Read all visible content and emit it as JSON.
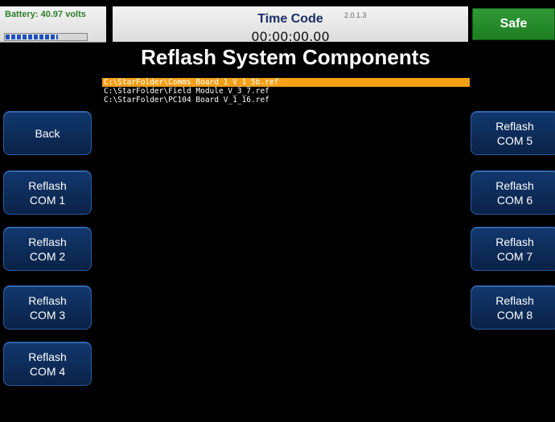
{
  "header": {
    "battery_label": "Battery: 40.97 volts",
    "battery_level": 0.65,
    "timecode_title": "Time Code",
    "version": "2.0.1.3",
    "timecode_value": "00:00:00.00",
    "safe_label": "Safe"
  },
  "page_title": "Reflash System Components",
  "files": [
    {
      "path": "C:\\StarFolder\\Comms Board 1 V_1_5b.ref",
      "selected": true
    },
    {
      "path": "C:\\StarFolder\\Field Module V_3_7.ref",
      "selected": false
    },
    {
      "path": "C:\\StarFolder\\PC104 Board V_1_16.ref",
      "selected": false
    }
  ],
  "buttons": {
    "back": "Back",
    "reflash_word": "Reflash",
    "com1": "COM 1",
    "com2": "COM 2",
    "com3": "COM 3",
    "com4": "COM 4",
    "com5": "COM 5",
    "com6": "COM 6",
    "com7": "COM 7",
    "com8": "COM 8"
  },
  "colors": {
    "selection": "#f4a017",
    "safe": "#2f9a35",
    "button": "#12386e"
  }
}
